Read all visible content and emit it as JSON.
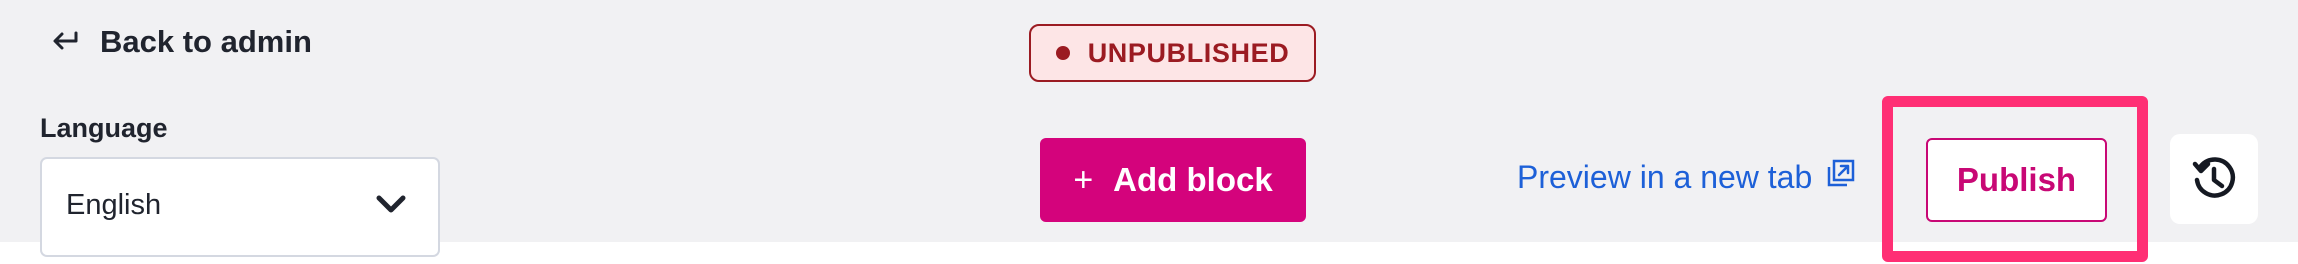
{
  "toolbar": {
    "back_label": "Back to admin",
    "status": "UNPUBLISHED",
    "language": {
      "label": "Language",
      "selected": "English"
    },
    "add_block_label": "Add block",
    "preview_label": "Preview in a new tab",
    "publish_label": "Publish"
  },
  "icons": {
    "back": "return-arrow-icon",
    "status": "status-dot",
    "dropdown": "chevron-down-icon",
    "add": "plus-icon",
    "preview": "external-link-icon",
    "history": "history-icon"
  },
  "colors": {
    "toolbar_background": "#f1f1f3",
    "unpublished_text": "#9b1b22",
    "unpublished_background": "#fde5e6",
    "primary_pink": "#d4037c",
    "link_blue": "#1d60d8",
    "highlight": "#ff2f74"
  }
}
